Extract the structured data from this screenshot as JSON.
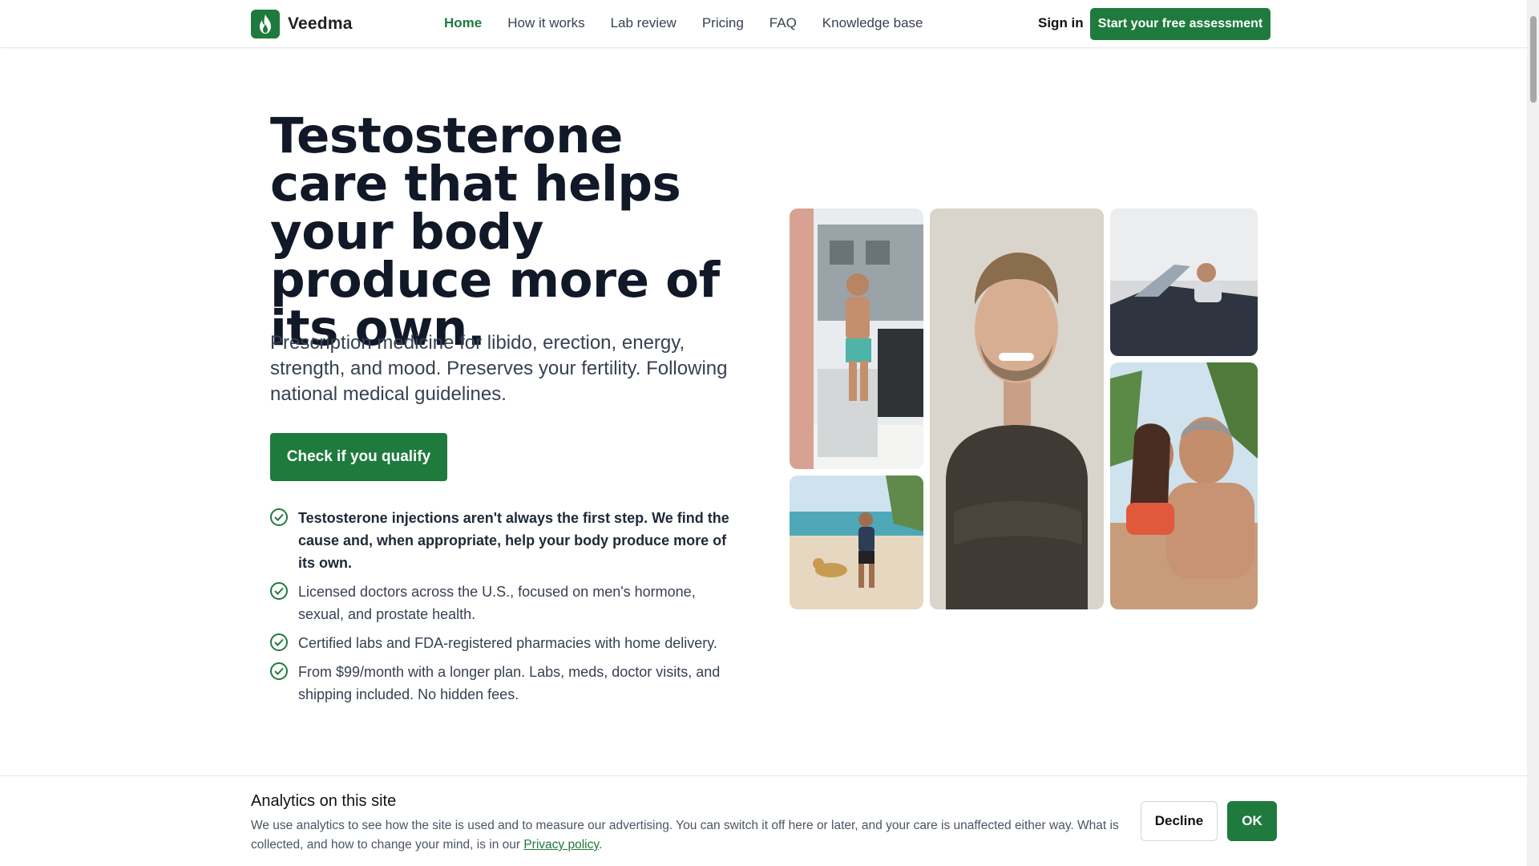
{
  "header": {
    "brand": "Veedma",
    "brand_icon": "flame-icon",
    "nav": [
      {
        "label": "Home",
        "active": true
      },
      {
        "label": "How it works",
        "active": false
      },
      {
        "label": "Lab review",
        "active": false
      },
      {
        "label": "Pricing",
        "active": false
      },
      {
        "label": "FAQ",
        "active": false
      },
      {
        "label": "Knowledge base",
        "active": false
      }
    ],
    "sign_in": "Sign in",
    "cta": "Start your free assessment"
  },
  "hero": {
    "title": "Testosterone care that helps your body produce more of its own.",
    "subtitle": "Prescription medicine for libido, erection, energy, strength, and mood. Preserves your fertility. Following national medical guidelines.",
    "button": "Check if you qualify",
    "checks": [
      {
        "text": "Testosterone injections aren't always the first step. We find the cause and, when appropriate, help your body produce more of its own.",
        "bold": true
      },
      {
        "text": "Licensed doctors across the U.S., focused on men's hormone, sexual, and prostate health.",
        "bold": false
      },
      {
        "text": "Certified labs and FDA-registered pharmacies with home delivery.",
        "bold": false
      },
      {
        "text": "From $99/month with a longer plan. Labs, meds, doctor visits, and shipping included. No hidden fees.",
        "bold": false
      }
    ]
  },
  "photos": [
    {
      "name": "photo-man-beach-truck"
    },
    {
      "name": "photo-man-running-dog"
    },
    {
      "name": "photo-smiling-man-portrait"
    },
    {
      "name": "photo-man-convertible-car"
    },
    {
      "name": "photo-couple-beach"
    }
  ],
  "cookie": {
    "title": "Analytics on this site",
    "text": "We use analytics to see how the site is used and to measure our advertising. You can switch it off here or later, and your care is unaffected either way. What is collected, and how to change your mind, is in our",
    "link": "Privacy policy",
    "text_end": ".",
    "decline": "Decline",
    "ok": "OK"
  },
  "colors": {
    "brand_green": "#1f7a3d",
    "heading": "#111827",
    "body": "#374151"
  }
}
